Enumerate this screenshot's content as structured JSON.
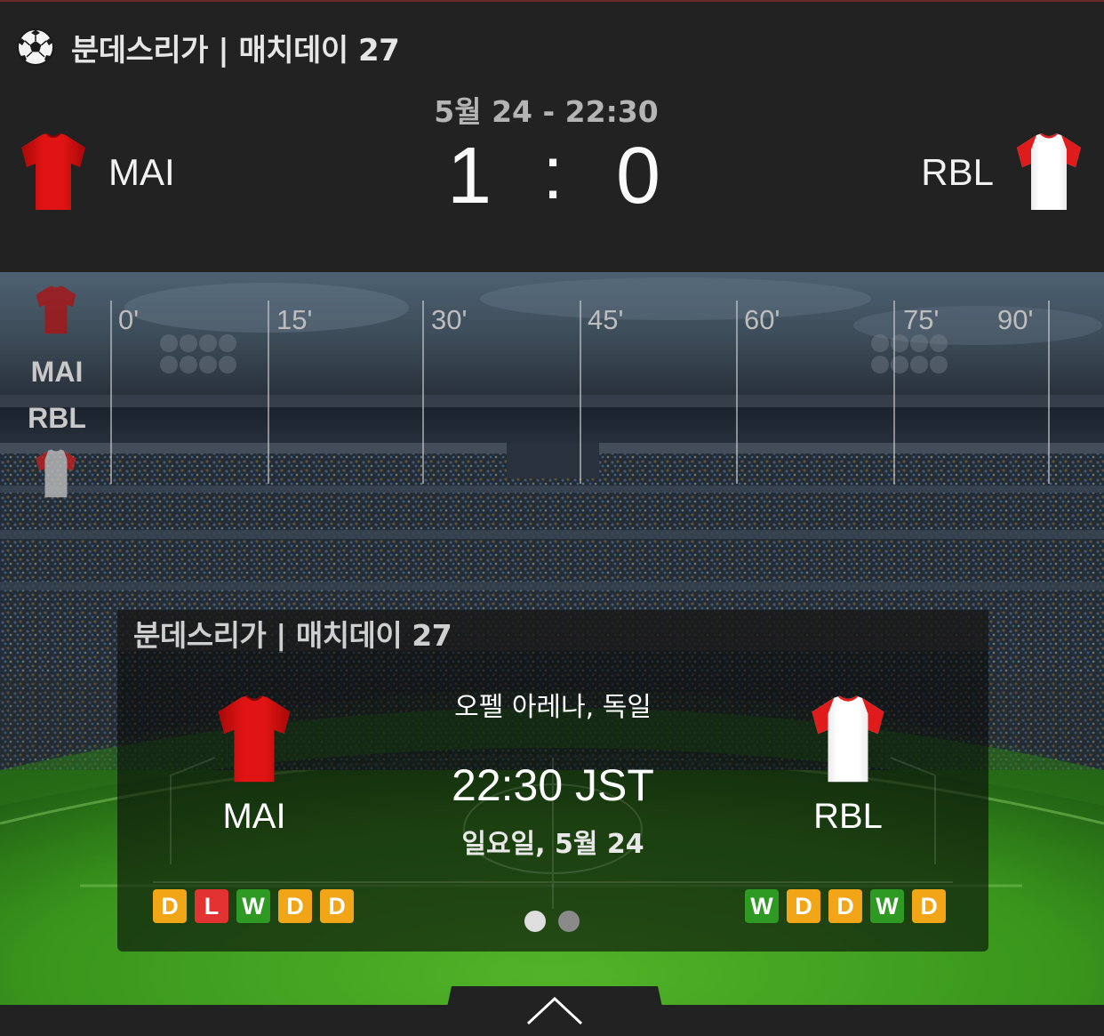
{
  "header": {
    "league_title": "분데스리가 | 매치데이 27",
    "match_date": "5월 24  -  22:30",
    "home_team": "MAI",
    "away_team": "RBL",
    "score_home": "1",
    "score_separator": ":",
    "score_away": "0",
    "league_icon": "soccer-ball-icon"
  },
  "timeline": {
    "labels": [
      "0'",
      "15'",
      "30'",
      "45'",
      "60'",
      "75'",
      "90'"
    ],
    "home_team": "MAI",
    "away_team": "RBL"
  },
  "card": {
    "title": "분데스리가 | 매치데이 27",
    "home_team": "MAI",
    "away_team": "RBL",
    "venue": "오펠 아레나, 독일",
    "kickoff_time": "22:30 JST",
    "kickoff_date": "일요일, 5월 24",
    "home_form": [
      "D",
      "L",
      "W",
      "D",
      "D"
    ],
    "away_form": [
      "W",
      "D",
      "D",
      "W",
      "D"
    ],
    "page_count": 2,
    "active_page": 1
  },
  "bottom": {
    "toggle_icon": "chevron-up-icon"
  },
  "colors": {
    "home_kit": "#d40f0f",
    "away_kit": "#f2f2f2",
    "away_kit_sleeves": "#e01b1b",
    "form_draw": "#f2a516",
    "form_loss": "#e23232",
    "form_win": "#2e9a23",
    "pitch": "#3ea11f"
  }
}
